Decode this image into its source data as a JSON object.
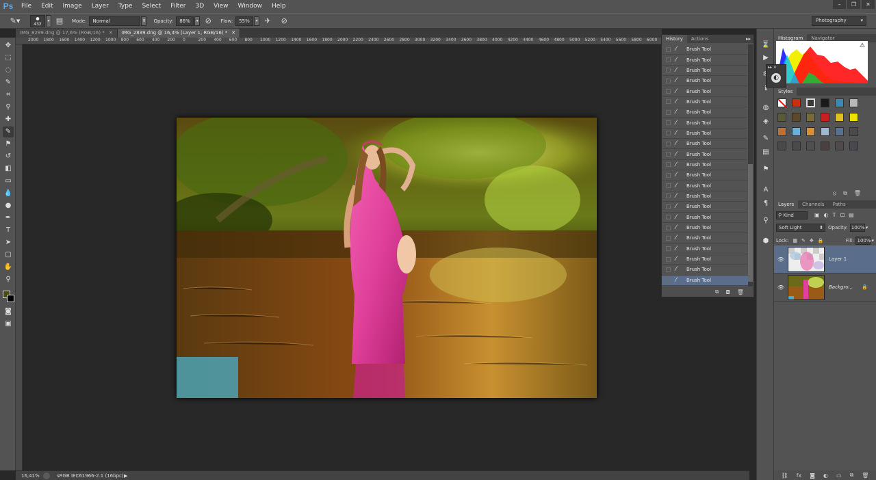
{
  "app": {
    "logo": "Ps"
  },
  "menu": [
    "File",
    "Edit",
    "Image",
    "Layer",
    "Type",
    "Select",
    "Filter",
    "3D",
    "View",
    "Window",
    "Help"
  ],
  "window_controls": [
    "–",
    "❐",
    "✕"
  ],
  "options": {
    "brush_size": "432",
    "mode_label": "Mode:",
    "mode_value": "Normal",
    "opacity_label": "Opacity:",
    "opacity_value": "86%",
    "flow_label": "Flow:",
    "flow_value": "55%",
    "workspace": "Photography"
  },
  "tabs": [
    {
      "label": "IMG_8299.dng @ 17,6% (RGB/16) *",
      "close": "✕"
    },
    {
      "label": "IMG_2839.dng @ 16,4% (Layer 1, RGB/16) *",
      "close": "✕"
    }
  ],
  "ruler_h": [
    "2000",
    "1800",
    "1600",
    "1400",
    "1200",
    "1000",
    "800",
    "600",
    "400",
    "200",
    "0",
    "200",
    "400",
    "600",
    "800",
    "1000",
    "1200",
    "1400",
    "1600",
    "1800",
    "2000",
    "2200",
    "2400",
    "2600",
    "2800",
    "3000",
    "3200",
    "3400",
    "3600",
    "3800",
    "4000",
    "4200",
    "4400",
    "4600",
    "4800",
    "5000",
    "5200",
    "5400",
    "5600",
    "5800",
    "6000",
    "62"
  ],
  "status": {
    "zoom": "16,41%",
    "profile": "sRGB IEC61966-2.1 (16bpc)",
    "arrow": "▶"
  },
  "history": {
    "tabs": [
      "History",
      "Actions"
    ],
    "items": [
      "Brush Tool",
      "Brush Tool",
      "Brush Tool",
      "Brush Tool",
      "Brush Tool",
      "Brush Tool",
      "Brush Tool",
      "Brush Tool",
      "Brush Tool",
      "Brush Tool",
      "Brush Tool",
      "Brush Tool",
      "Brush Tool",
      "Brush Tool",
      "Brush Tool",
      "Brush Tool",
      "Brush Tool",
      "Brush Tool",
      "Brush Tool",
      "Brush Tool",
      "Brush Tool",
      "Brush Tool",
      "Brush Tool"
    ]
  },
  "histogram": {
    "tabs": [
      "Histogram",
      "Navigator"
    ]
  },
  "styles": {
    "tab": "Styles"
  },
  "layers": {
    "tabs": [
      "Layers",
      "Channels",
      "Paths"
    ],
    "filter": "Kind",
    "blend_mode": "Soft Light",
    "opacity_label": "Opacity:",
    "opacity_value": "100%",
    "lock_label": "Lock:",
    "fill_label": "Fill:",
    "fill_value": "100%",
    "items": [
      {
        "name": "Layer 1",
        "selected": true
      },
      {
        "name": "Backgro...",
        "selected": false
      }
    ]
  },
  "colors": {
    "accent_selected": "#5a6e8c",
    "foreground_color": "#4a4a10",
    "background_color": "#000000"
  }
}
